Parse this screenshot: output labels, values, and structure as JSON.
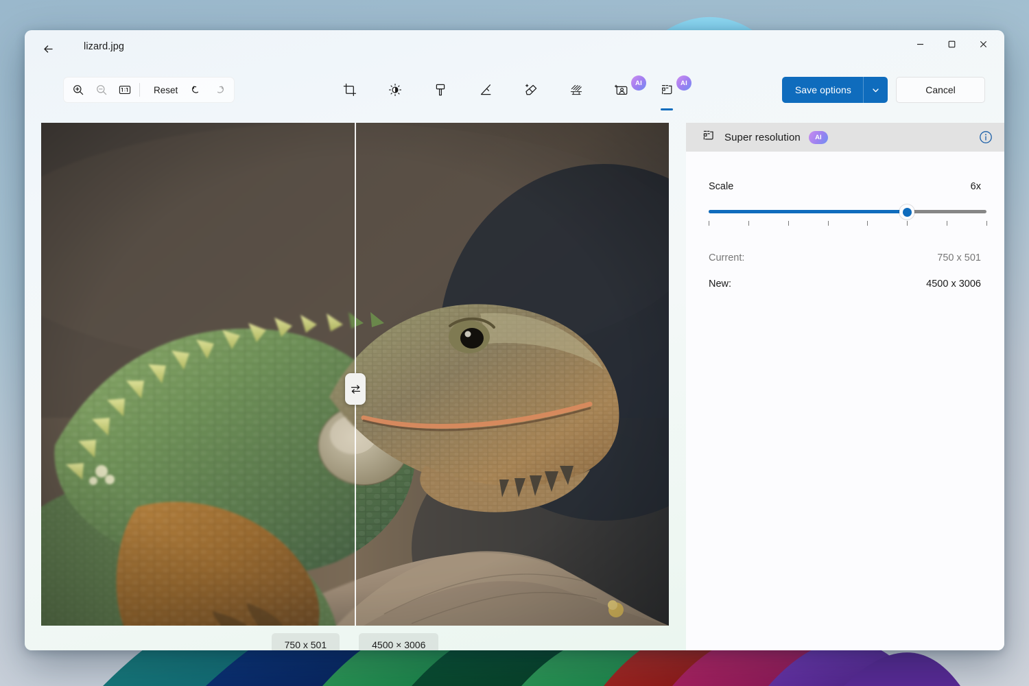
{
  "window": {
    "back_label": "back-arrow",
    "title": "lizard.jpg",
    "controls": {
      "minimize": "minimize",
      "maximize": "maximize",
      "close": "close"
    }
  },
  "toolbar": {
    "zoom_in": "zoom-in",
    "zoom_out": "zoom-out",
    "actual_size": "1:1",
    "reset_label": "Reset",
    "undo": "undo",
    "redo": "redo",
    "tools": [
      {
        "name": "crop-tool",
        "icon": "crop-icon",
        "ai": false,
        "active": false
      },
      {
        "name": "adjust-tool",
        "icon": "brightness-icon",
        "ai": false,
        "active": false
      },
      {
        "name": "highlighter-tool",
        "icon": "highlighter-icon",
        "ai": false,
        "active": false
      },
      {
        "name": "pen-tool",
        "icon": "pen-icon",
        "ai": false,
        "active": false
      },
      {
        "name": "erase-tool",
        "icon": "magic-eraser-icon",
        "ai": false,
        "active": false
      },
      {
        "name": "blur-tool",
        "icon": "blur-icon",
        "ai": false,
        "active": false
      },
      {
        "name": "background-removal-tool",
        "icon": "person-background-icon",
        "ai": true,
        "active": false
      },
      {
        "name": "super-resolution-tool",
        "icon": "super-resolution-icon",
        "ai": true,
        "active": true
      }
    ],
    "ai_badge_text": "AI",
    "save_label": "Save options",
    "save_chevron": "chevron-down-icon",
    "cancel_label": "Cancel"
  },
  "canvas": {
    "swap_icon": "swap-arrows-icon",
    "divider_position_pct": 50,
    "chips": [
      {
        "label": "750 x 501"
      },
      {
        "label": "4500 × 3006"
      }
    ]
  },
  "panel": {
    "icon": "super-resolution-icon",
    "title": "Super resolution",
    "ai_badge_text": "AI",
    "info_icon": "info-icon",
    "scale": {
      "label": "Scale",
      "value_text": "6x",
      "value": 6,
      "min": 1,
      "max": 8,
      "tick_count": 8
    },
    "current": {
      "label": "Current:",
      "value": "750 x 501"
    },
    "new": {
      "label": "New:",
      "value": "4500 x 3006"
    }
  },
  "colors": {
    "accent": "#0f6cbd",
    "ai_badge_start": "#c98cf0",
    "ai_badge_end": "#6e8ff2",
    "panel_header": "#e2e2e2",
    "desktop": "#9ab8cc"
  }
}
